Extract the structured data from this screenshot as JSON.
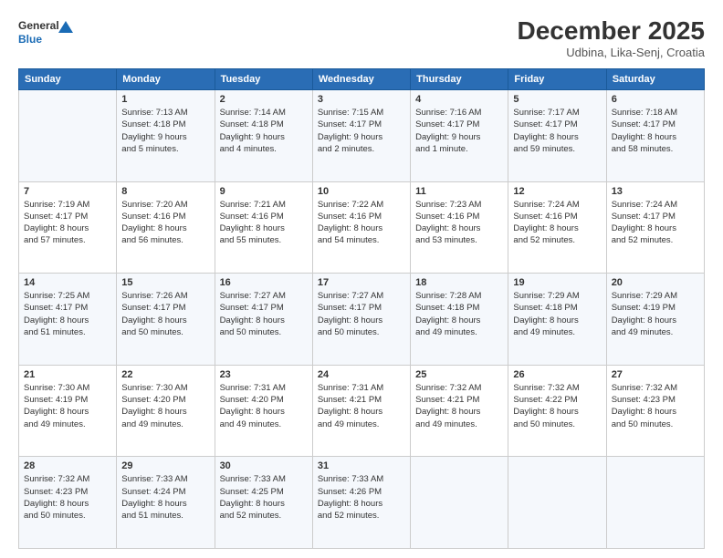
{
  "header": {
    "logo_line1": "General",
    "logo_line2": "Blue",
    "month_title": "December 2025",
    "subtitle": "Udbina, Lika-Senj, Croatia"
  },
  "weekdays": [
    "Sunday",
    "Monday",
    "Tuesday",
    "Wednesday",
    "Thursday",
    "Friday",
    "Saturday"
  ],
  "weeks": [
    [
      {
        "day": "",
        "info": ""
      },
      {
        "day": "1",
        "info": "Sunrise: 7:13 AM\nSunset: 4:18 PM\nDaylight: 9 hours\nand 5 minutes."
      },
      {
        "day": "2",
        "info": "Sunrise: 7:14 AM\nSunset: 4:18 PM\nDaylight: 9 hours\nand 4 minutes."
      },
      {
        "day": "3",
        "info": "Sunrise: 7:15 AM\nSunset: 4:17 PM\nDaylight: 9 hours\nand 2 minutes."
      },
      {
        "day": "4",
        "info": "Sunrise: 7:16 AM\nSunset: 4:17 PM\nDaylight: 9 hours\nand 1 minute."
      },
      {
        "day": "5",
        "info": "Sunrise: 7:17 AM\nSunset: 4:17 PM\nDaylight: 8 hours\nand 59 minutes."
      },
      {
        "day": "6",
        "info": "Sunrise: 7:18 AM\nSunset: 4:17 PM\nDaylight: 8 hours\nand 58 minutes."
      }
    ],
    [
      {
        "day": "7",
        "info": "Sunrise: 7:19 AM\nSunset: 4:17 PM\nDaylight: 8 hours\nand 57 minutes."
      },
      {
        "day": "8",
        "info": "Sunrise: 7:20 AM\nSunset: 4:16 PM\nDaylight: 8 hours\nand 56 minutes."
      },
      {
        "day": "9",
        "info": "Sunrise: 7:21 AM\nSunset: 4:16 PM\nDaylight: 8 hours\nand 55 minutes."
      },
      {
        "day": "10",
        "info": "Sunrise: 7:22 AM\nSunset: 4:16 PM\nDaylight: 8 hours\nand 54 minutes."
      },
      {
        "day": "11",
        "info": "Sunrise: 7:23 AM\nSunset: 4:16 PM\nDaylight: 8 hours\nand 53 minutes."
      },
      {
        "day": "12",
        "info": "Sunrise: 7:24 AM\nSunset: 4:16 PM\nDaylight: 8 hours\nand 52 minutes."
      },
      {
        "day": "13",
        "info": "Sunrise: 7:24 AM\nSunset: 4:17 PM\nDaylight: 8 hours\nand 52 minutes."
      }
    ],
    [
      {
        "day": "14",
        "info": "Sunrise: 7:25 AM\nSunset: 4:17 PM\nDaylight: 8 hours\nand 51 minutes."
      },
      {
        "day": "15",
        "info": "Sunrise: 7:26 AM\nSunset: 4:17 PM\nDaylight: 8 hours\nand 50 minutes."
      },
      {
        "day": "16",
        "info": "Sunrise: 7:27 AM\nSunset: 4:17 PM\nDaylight: 8 hours\nand 50 minutes."
      },
      {
        "day": "17",
        "info": "Sunrise: 7:27 AM\nSunset: 4:17 PM\nDaylight: 8 hours\nand 50 minutes."
      },
      {
        "day": "18",
        "info": "Sunrise: 7:28 AM\nSunset: 4:18 PM\nDaylight: 8 hours\nand 49 minutes."
      },
      {
        "day": "19",
        "info": "Sunrise: 7:29 AM\nSunset: 4:18 PM\nDaylight: 8 hours\nand 49 minutes."
      },
      {
        "day": "20",
        "info": "Sunrise: 7:29 AM\nSunset: 4:19 PM\nDaylight: 8 hours\nand 49 minutes."
      }
    ],
    [
      {
        "day": "21",
        "info": "Sunrise: 7:30 AM\nSunset: 4:19 PM\nDaylight: 8 hours\nand 49 minutes."
      },
      {
        "day": "22",
        "info": "Sunrise: 7:30 AM\nSunset: 4:20 PM\nDaylight: 8 hours\nand 49 minutes."
      },
      {
        "day": "23",
        "info": "Sunrise: 7:31 AM\nSunset: 4:20 PM\nDaylight: 8 hours\nand 49 minutes."
      },
      {
        "day": "24",
        "info": "Sunrise: 7:31 AM\nSunset: 4:21 PM\nDaylight: 8 hours\nand 49 minutes."
      },
      {
        "day": "25",
        "info": "Sunrise: 7:32 AM\nSunset: 4:21 PM\nDaylight: 8 hours\nand 49 minutes."
      },
      {
        "day": "26",
        "info": "Sunrise: 7:32 AM\nSunset: 4:22 PM\nDaylight: 8 hours\nand 50 minutes."
      },
      {
        "day": "27",
        "info": "Sunrise: 7:32 AM\nSunset: 4:23 PM\nDaylight: 8 hours\nand 50 minutes."
      }
    ],
    [
      {
        "day": "28",
        "info": "Sunrise: 7:32 AM\nSunset: 4:23 PM\nDaylight: 8 hours\nand 50 minutes."
      },
      {
        "day": "29",
        "info": "Sunrise: 7:33 AM\nSunset: 4:24 PM\nDaylight: 8 hours\nand 51 minutes."
      },
      {
        "day": "30",
        "info": "Sunrise: 7:33 AM\nSunset: 4:25 PM\nDaylight: 8 hours\nand 52 minutes."
      },
      {
        "day": "31",
        "info": "Sunrise: 7:33 AM\nSunset: 4:26 PM\nDaylight: 8 hours\nand 52 minutes."
      },
      {
        "day": "",
        "info": ""
      },
      {
        "day": "",
        "info": ""
      },
      {
        "day": "",
        "info": ""
      }
    ]
  ]
}
